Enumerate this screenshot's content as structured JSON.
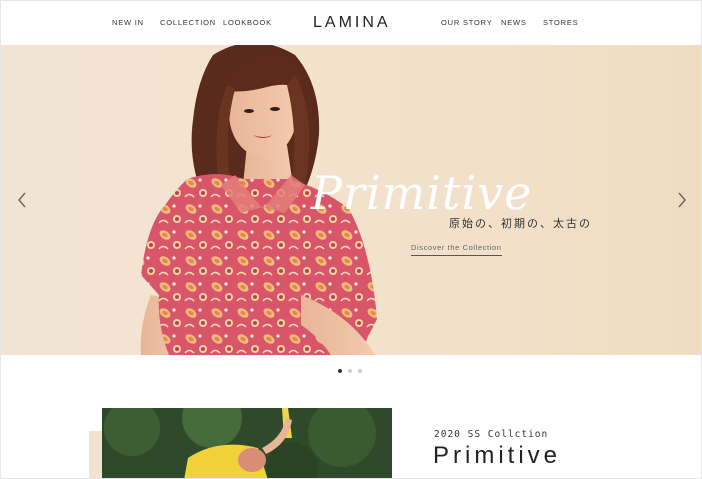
{
  "header": {
    "nav_left": [
      "NEW IN",
      "COLLECTION",
      "LOOKBOOK"
    ],
    "logo": "LAMINA",
    "nav_right": [
      "OUR STORY",
      "NEWS",
      "STORES"
    ]
  },
  "hero": {
    "script_title": "Primitive",
    "subtitle_jp": "原始の、初期の、太古の",
    "cta_label": "Discover the Collection",
    "prev_icon": "chevron-left-icon",
    "next_icon": "chevron-right-icon"
  },
  "carousel": {
    "slide_count": 3,
    "active_index": 0
  },
  "collection": {
    "season": "2020 SS Collction",
    "title": "Primitive"
  },
  "colors": {
    "hero_bg": "#f1e4d2",
    "text_dark": "#222222",
    "dot_active": "#333333",
    "dot_inactive": "#cccccc"
  }
}
